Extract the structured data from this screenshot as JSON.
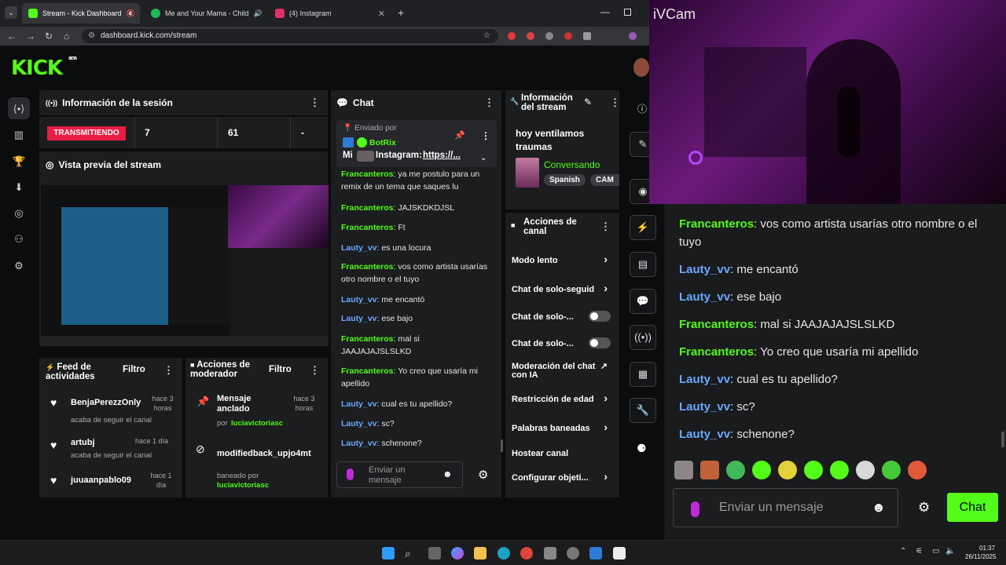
{
  "browser": {
    "tabs": [
      {
        "title": "Stream - Kick Dashboard",
        "active": true
      },
      {
        "title": "Me and Your Mama - Child",
        "active": false
      },
      {
        "title": "(4) Instagram",
        "active": false
      }
    ],
    "new_tab": "+",
    "url": "dashboard.kick.com/stream"
  },
  "brand": {
    "logo": "KICK",
    "beta": "BETA",
    "color": "#53fc18"
  },
  "session": {
    "title": "Información de la sesión",
    "status": "TRANSMITIENDO",
    "viewers": "7",
    "followers": "61",
    "other": "-"
  },
  "preview": {
    "title": "Vista previa del stream"
  },
  "chat": {
    "title": "Chat",
    "pinned_label": "Enviado por",
    "pinned_user": "BotRix",
    "pinned_msg_prefix": "Mi",
    "pinned_msg": "Instagram:",
    "pinned_link": "https://...",
    "messages": [
      {
        "user": "Francanteros",
        "text": "ya me postulo para un remix de un tema que saques lu",
        "color": "green"
      },
      {
        "user": "Francanteros",
        "text": "JAJSKDKDJSL",
        "color": "green"
      },
      {
        "user": "Francanteros",
        "text": "Ft",
        "color": "green"
      },
      {
        "user": "Lauty_vv",
        "text": "es una locura",
        "color": "blue"
      },
      {
        "user": "Francanteros",
        "text": "vos como artista usarías otro nombre o el tuyo",
        "color": "green"
      },
      {
        "user": "Lauty_vv",
        "text": "me encantó",
        "color": "blue"
      },
      {
        "user": "Lauty_vv",
        "text": "ese bajo",
        "color": "blue"
      },
      {
        "user": "Francanteros",
        "text": "mal si JAAJAJAJSLSLKD",
        "color": "green"
      },
      {
        "user": "Francanteros",
        "text": "Yo creo que usaría mi apellido",
        "color": "green"
      },
      {
        "user": "Lauty_vv",
        "text": "cual es tu apellido?",
        "color": "blue"
      },
      {
        "user": "Lauty_vv",
        "text": "sc?",
        "color": "blue"
      },
      {
        "user": "Lauty_vv",
        "text": "schenone?",
        "color": "blue"
      }
    ],
    "input_placeholder": "Enviar un mensaje"
  },
  "stream_info": {
    "title": "Información del stream",
    "stream_title": "hoy ventilamos traumas",
    "category": "Conversando",
    "tags": [
      "Spanish",
      "CAM"
    ]
  },
  "channel_actions": {
    "title": "Acciones de canal",
    "items": [
      {
        "label": "Modo lento",
        "control": "chevron"
      },
      {
        "label": "Chat de solo-seguid",
        "control": "chevron"
      },
      {
        "label": "Chat de solo-...",
        "control": "toggle"
      },
      {
        "label": "Chat de solo-...",
        "control": "toggle"
      },
      {
        "label": "Moderación del chat con IA",
        "control": "external"
      },
      {
        "label": "Restricción de edad",
        "control": "chevron"
      },
      {
        "label": "Palabras baneadas",
        "control": "chevron"
      },
      {
        "label": "Hostear canal",
        "control": "none"
      },
      {
        "label": "Configurar objeti...",
        "control": "chevron"
      }
    ]
  },
  "activity": {
    "title": "Feed de actividades",
    "filter": "Filtro",
    "items": [
      {
        "user": "BenjaPerezzOnly",
        "time": "hace 3 horas",
        "desc": "acaba de seguir el canal"
      },
      {
        "user": "artubj",
        "time": "hace 1 día",
        "desc": "acaba de seguir el canal"
      },
      {
        "user": "juuaanpablo09",
        "time": "hace 1 día",
        "desc": ""
      }
    ]
  },
  "mod_actions": {
    "title": "Acciones de moderador",
    "filter": "Filtro",
    "items": [
      {
        "title": "Mensaje anclado",
        "time": "hace 3 horas",
        "by_label": "por",
        "by": "luciavictoriasc"
      },
      {
        "title": "modifiedback_upjo4mt",
        "time": "",
        "by_label": "baneado por",
        "by": "luciavictoriasc"
      }
    ]
  },
  "overlay": {
    "cam_label": "iVCam",
    "chat_messages": [
      {
        "user": "Francanteros",
        "text": "vos como artista usarías otro nombre o el tuyo",
        "color": "green"
      },
      {
        "user": "Lauty_vv",
        "text": "me encantó",
        "color": "blue"
      },
      {
        "user": "Lauty_vv",
        "text": "ese bajo",
        "color": "blue"
      },
      {
        "user": "Francanteros",
        "text": "mal si JAAJAJAJSLSLKD",
        "color": "green"
      },
      {
        "user": "Francanteros",
        "text": "Yo creo que usaría mi apellido",
        "color": "green"
      },
      {
        "user": "Lauty_vv",
        "text": "cual es tu apellido?",
        "color": "blue"
      },
      {
        "user": "Lauty_vv",
        "text": "sc?",
        "color": "blue"
      },
      {
        "user": "Lauty_vv",
        "text": "schenone?",
        "color": "blue"
      }
    ],
    "input_placeholder": "Enviar un mensaje",
    "send_label": "Chat"
  },
  "taskbar": {
    "time": "01:37",
    "date": "26/11/2025"
  }
}
